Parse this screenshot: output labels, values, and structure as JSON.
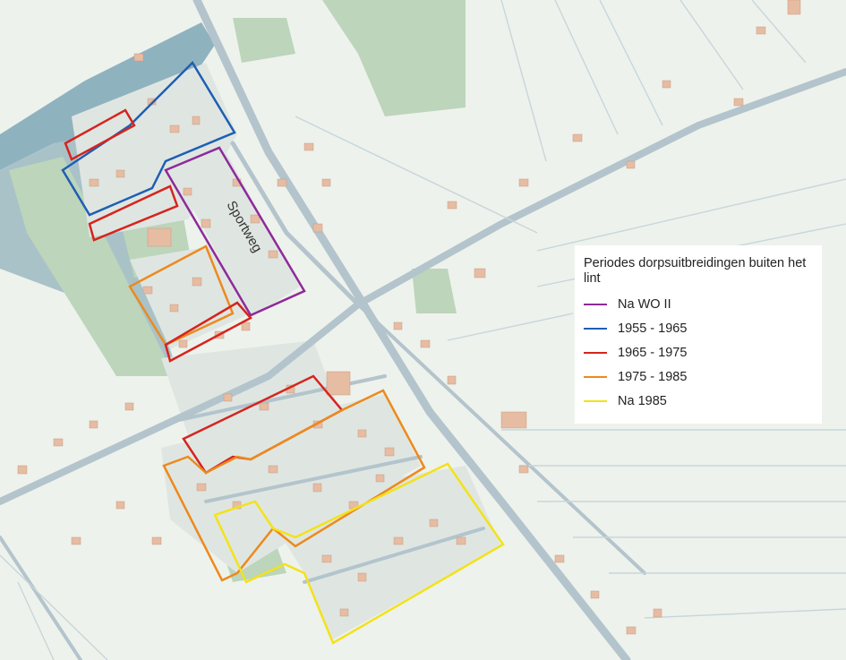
{
  "map": {
    "street_label": "Sportweg"
  },
  "legend": {
    "title": "Periodes dorpsuitbreidingen buiten het lint",
    "items": [
      {
        "label": "Na WO II",
        "color": "#8e2a9a"
      },
      {
        "label": "1955 - 1965",
        "color": "#1f5fb3"
      },
      {
        "label": "1965 - 1975",
        "color": "#d6241e"
      },
      {
        "label": "1975 - 1985",
        "color": "#ec8a1d"
      },
      {
        "label": "Na 1985",
        "color": "#f3e21a"
      }
    ]
  },
  "colors": {
    "background": "#eef2ec",
    "grass": "#b9d3b6",
    "water": "#9cb8c8",
    "road": "#b7c7cf",
    "building": "#e4b9a0"
  }
}
